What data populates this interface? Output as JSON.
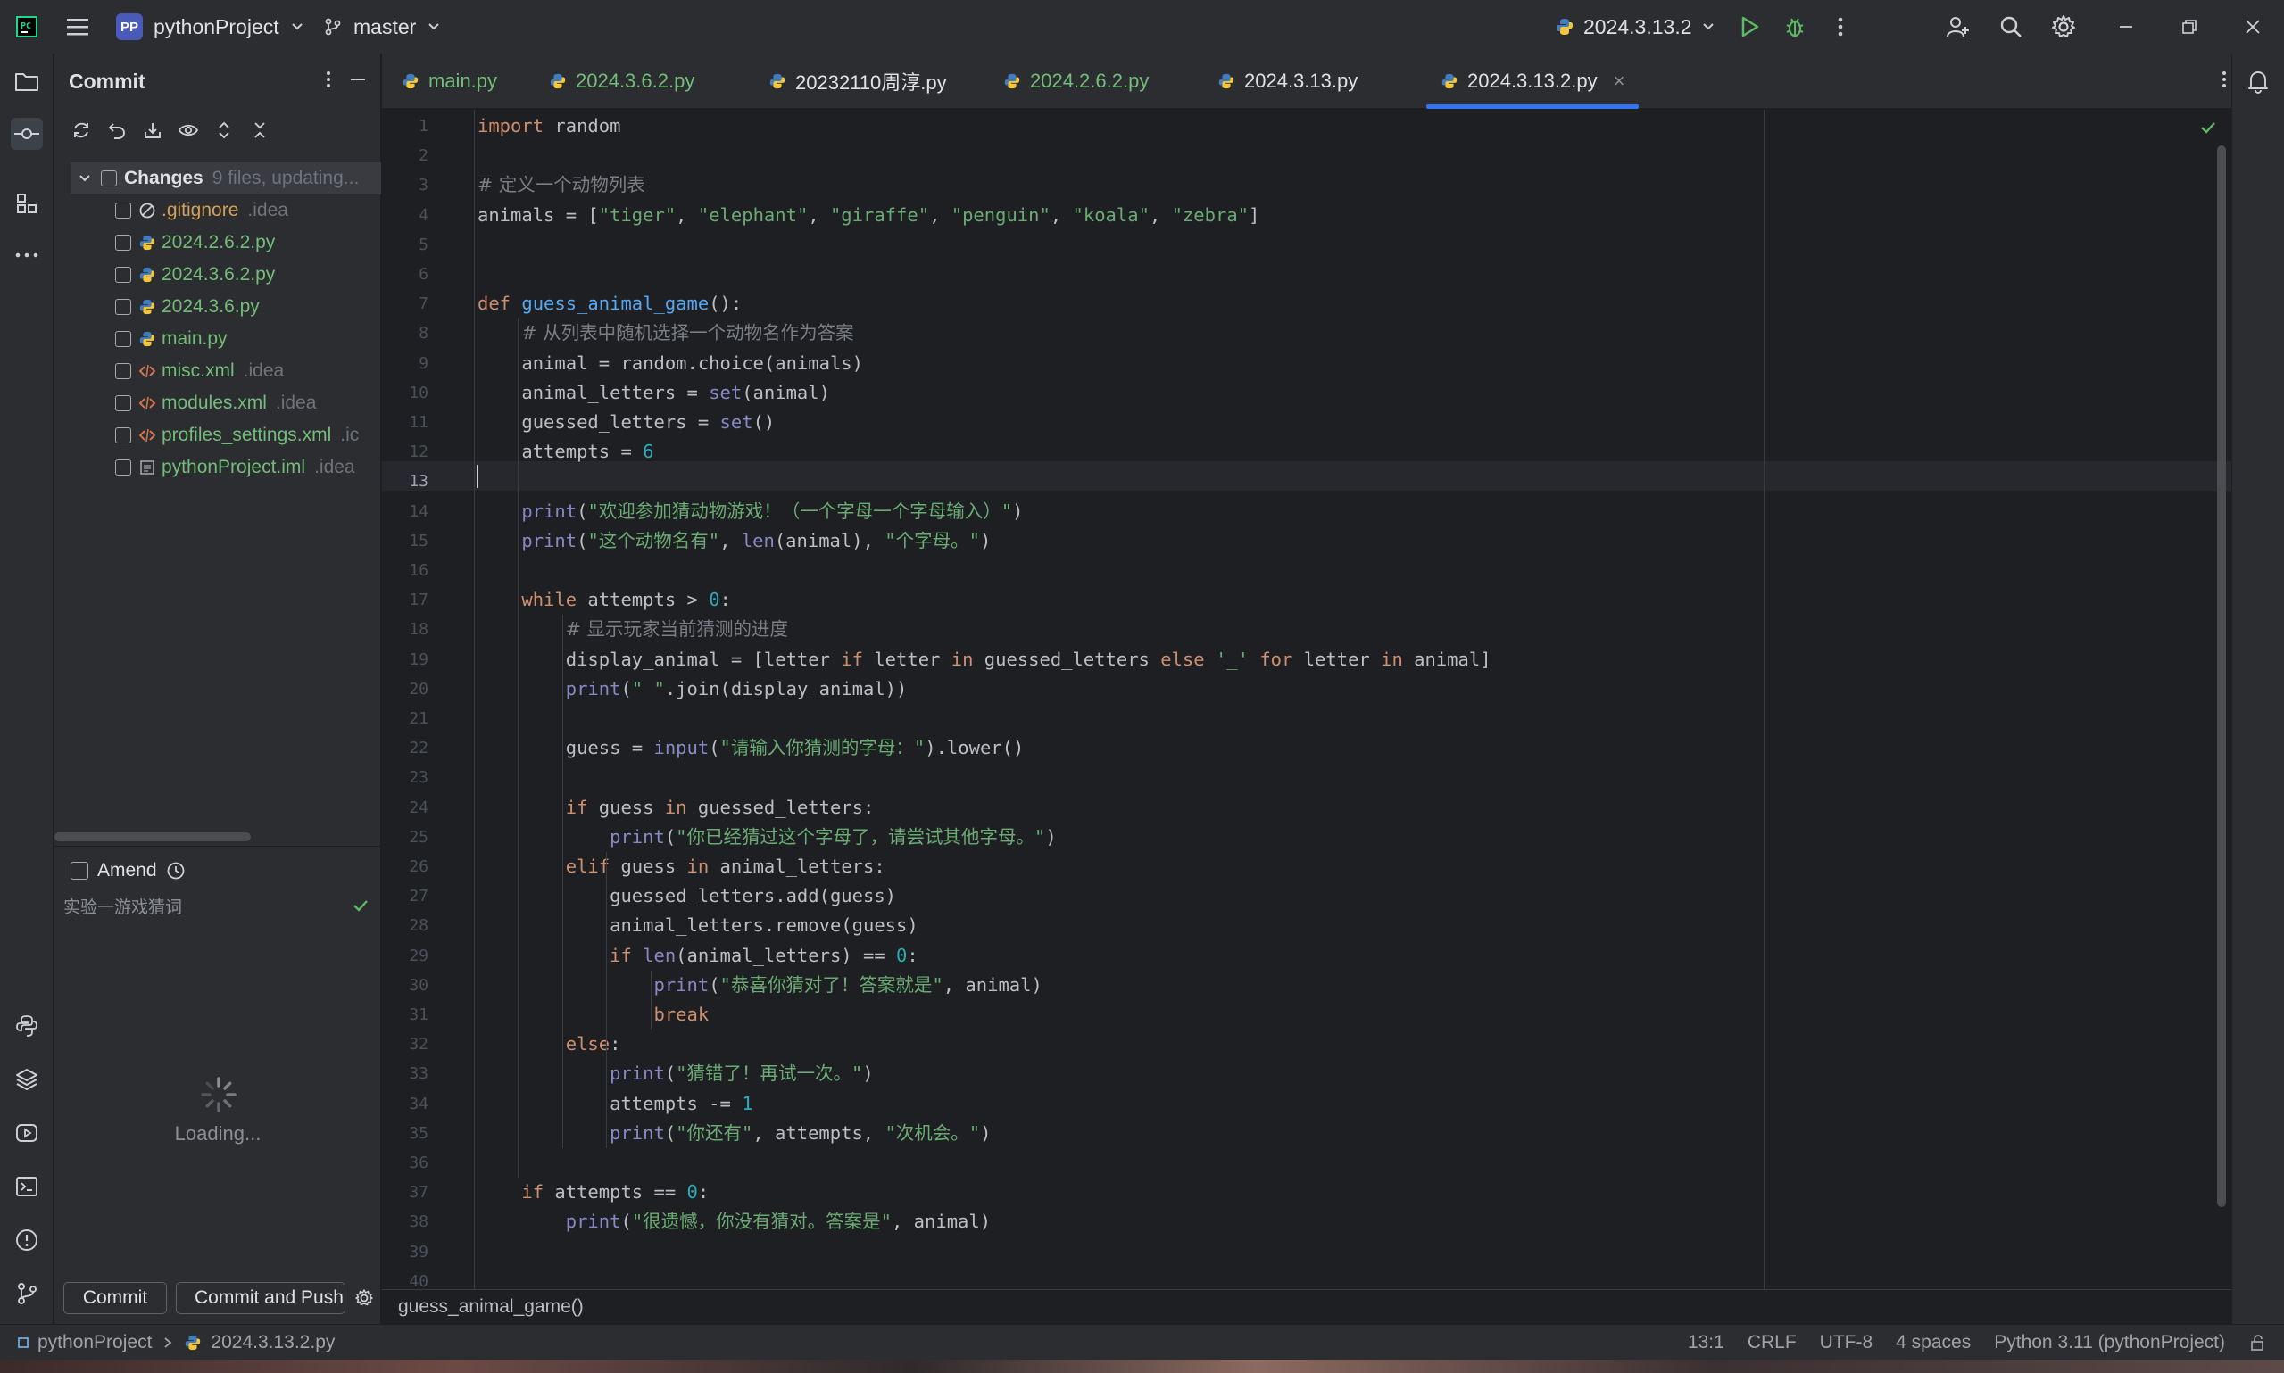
{
  "titlebar": {
    "project_badge": "PP",
    "project_name": "pythonProject",
    "branch": "master",
    "run_config": "2024.3.13.2"
  },
  "commit_panel": {
    "title": "Commit",
    "group_label": "Changes",
    "group_meta": "9 files, updating...",
    "files": [
      {
        "name": ".gitignore",
        "meta": ".idea",
        "status": "ignored",
        "icon": "ignore-icon"
      },
      {
        "name": "2024.2.6.2.py",
        "meta": "",
        "status": "modified",
        "icon": "python-file-icon"
      },
      {
        "name": "2024.3.6.2.py",
        "meta": "",
        "status": "modified",
        "icon": "python-file-icon"
      },
      {
        "name": "2024.3.6.py",
        "meta": "",
        "status": "modified",
        "icon": "python-file-icon"
      },
      {
        "name": "main.py",
        "meta": "",
        "status": "modified",
        "icon": "python-file-icon"
      },
      {
        "name": "misc.xml",
        "meta": ".idea",
        "status": "modified",
        "icon": "xml-file-icon"
      },
      {
        "name": "modules.xml",
        "meta": ".idea",
        "status": "modified",
        "icon": "xml-file-icon"
      },
      {
        "name": "profiles_settings.xml",
        "meta": ".ic",
        "status": "modified",
        "icon": "xml-file-icon"
      },
      {
        "name": "pythonProject.iml",
        "meta": ".idea",
        "status": "modified",
        "icon": "iml-file-icon"
      }
    ],
    "amend_label": "Amend",
    "commit_message": "实验一游戏猜词",
    "loading_text": "Loading...",
    "commit_button": "Commit",
    "commit_push_button": "Commit and Push"
  },
  "tabs": [
    {
      "label": "main.py",
      "color": "#73bd79",
      "active": false
    },
    {
      "label": "2024.3.6.2.py",
      "color": "#73bd79",
      "active": false
    },
    {
      "label": "20232110周淳.py",
      "color": "#dfe1e5",
      "active": false
    },
    {
      "label": "2024.2.6.2.py",
      "color": "#73bd79",
      "active": false
    },
    {
      "label": "2024.3.13.py",
      "color": "#dfe1e5",
      "active": false
    },
    {
      "label": "2024.3.13.2.py",
      "color": "#dfe1e5",
      "active": true
    }
  ],
  "editor": {
    "line_numbers": [
      "1",
      "2",
      "3",
      "4",
      "5",
      "6",
      "7",
      "8",
      "9",
      "10",
      "11",
      "12",
      "13",
      "14",
      "15",
      "16",
      "17",
      "18",
      "19",
      "20",
      "21",
      "22",
      "23",
      "24",
      "25",
      "26",
      "27",
      "28",
      "29",
      "30",
      "31",
      "32",
      "33",
      "34",
      "35",
      "36",
      "37",
      "38",
      "39",
      "40"
    ],
    "current_line": 13,
    "code_lines": [
      "import random",
      "",
      "# 定义一个动物列表",
      "animals = [\"tiger\", \"elephant\", \"giraffe\", \"penguin\", \"koala\", \"zebra\"]",
      "",
      "",
      "def guess_animal_game():",
      "    # 从列表中随机选择一个动物名作为答案",
      "    animal = random.choice(animals)",
      "    animal_letters = set(animal)",
      "    guessed_letters = set()",
      "    attempts = 6",
      "",
      "    print(\"欢迎参加猜动物游戏！（一个字母一个字母输入）\")",
      "    print(\"这个动物名有\", len(animal), \"个字母。\")",
      "",
      "    while attempts > 0:",
      "        # 显示玩家当前猜测的进度",
      "        display_animal = [letter if letter in guessed_letters else '_' for letter in animal]",
      "        print(\" \".join(display_animal))",
      "",
      "        guess = input(\"请输入你猜测的字母：\").lower()",
      "",
      "        if guess in guessed_letters:",
      "            print(\"你已经猜过这个字母了，请尝试其他字母。\")",
      "        elif guess in animal_letters:",
      "            guessed_letters.add(guess)",
      "            animal_letters.remove(guess)",
      "            if len(animal_letters) == 0:",
      "                print(\"恭喜你猜对了！答案就是\", animal)",
      "                break",
      "        else:",
      "            print(\"猜错了！再试一次。\")",
      "            attempts -= 1",
      "            print(\"你还有\", attempts, \"次机会。\")",
      "",
      "    if attempts == 0:",
      "        print(\"很遗憾，你没有猜对。答案是\", animal)",
      "",
      ""
    ],
    "breadcrumb": "guess_animal_game()"
  },
  "statusbar": {
    "project": "pythonProject",
    "file": "2024.3.13.2.py",
    "position": "13:1",
    "line_ending": "CRLF",
    "encoding": "UTF-8",
    "indent": "4 spaces",
    "interpreter": "Python 3.11 (pythonProject)"
  },
  "colors": {
    "accent": "#3574f0",
    "modified": "#73bd79",
    "ignored": "#d2a059",
    "run_green": "#5fb865"
  }
}
